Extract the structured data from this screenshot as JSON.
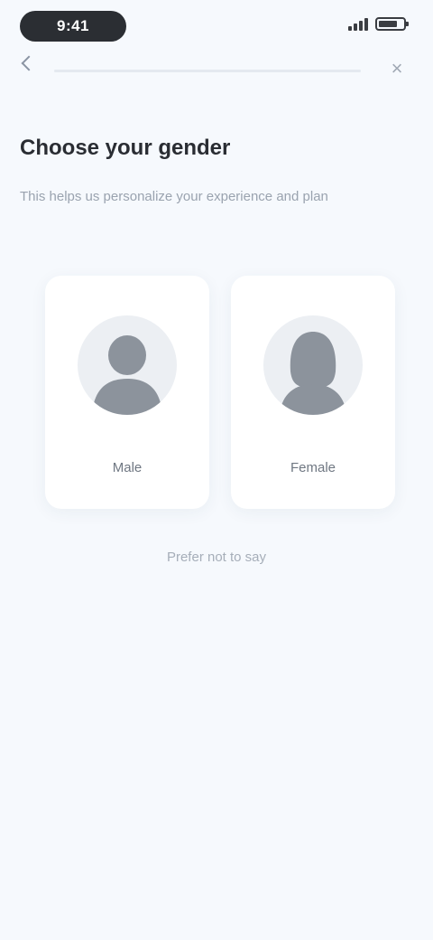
{
  "status_bar": {
    "time": "9:41",
    "icons": [
      "signal-icon",
      "battery-icon"
    ],
    "battery_level": 0.8
  },
  "nav": {
    "back_icon": "chevron-left-icon",
    "close_icon": "close-icon",
    "close_glyph": "×"
  },
  "header": {
    "title": "Choose your gender",
    "subtitle": "This helps us personalize your experience and plan"
  },
  "options": [
    {
      "label": "Male",
      "icon": "male-avatar-icon"
    },
    {
      "label": "Female",
      "icon": "female-avatar-icon"
    }
  ],
  "footer": {
    "skip_label": "Prefer not to say"
  },
  "colors": {
    "background": "#f6f9fd",
    "card": "#ffffff",
    "avatar_fill": "#eceff3",
    "figure": "#8c939c",
    "pill": "#2b2e33"
  }
}
